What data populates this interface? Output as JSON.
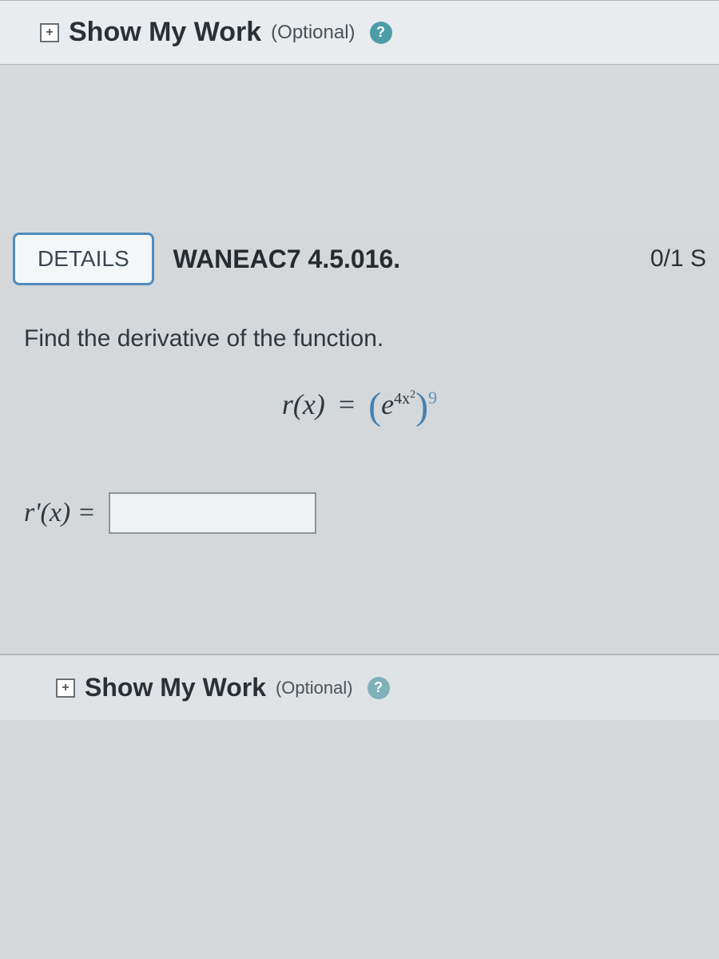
{
  "showWorkTop": {
    "title": "Show My Work",
    "optional": "(Optional)",
    "expandGlyph": "+",
    "helpGlyph": "?"
  },
  "header": {
    "detailsLabel": "DETAILS",
    "problemCode": "WANEAC7 4.5.016.",
    "score": "0/1 S"
  },
  "prompt": "Find the derivative of the function.",
  "equation": {
    "lhs": "r(x)",
    "equals": "=",
    "leftParen": "(",
    "base": "e",
    "innerExp": "4x",
    "innerExpPower": "2",
    "rightParen": ")",
    "outerPower": "9"
  },
  "answer": {
    "label": "r'(x) ="
  },
  "showWorkBottom": {
    "title": "Show My Work",
    "optional": "(Optional)",
    "expandGlyph": "+",
    "helpGlyph": "?"
  }
}
